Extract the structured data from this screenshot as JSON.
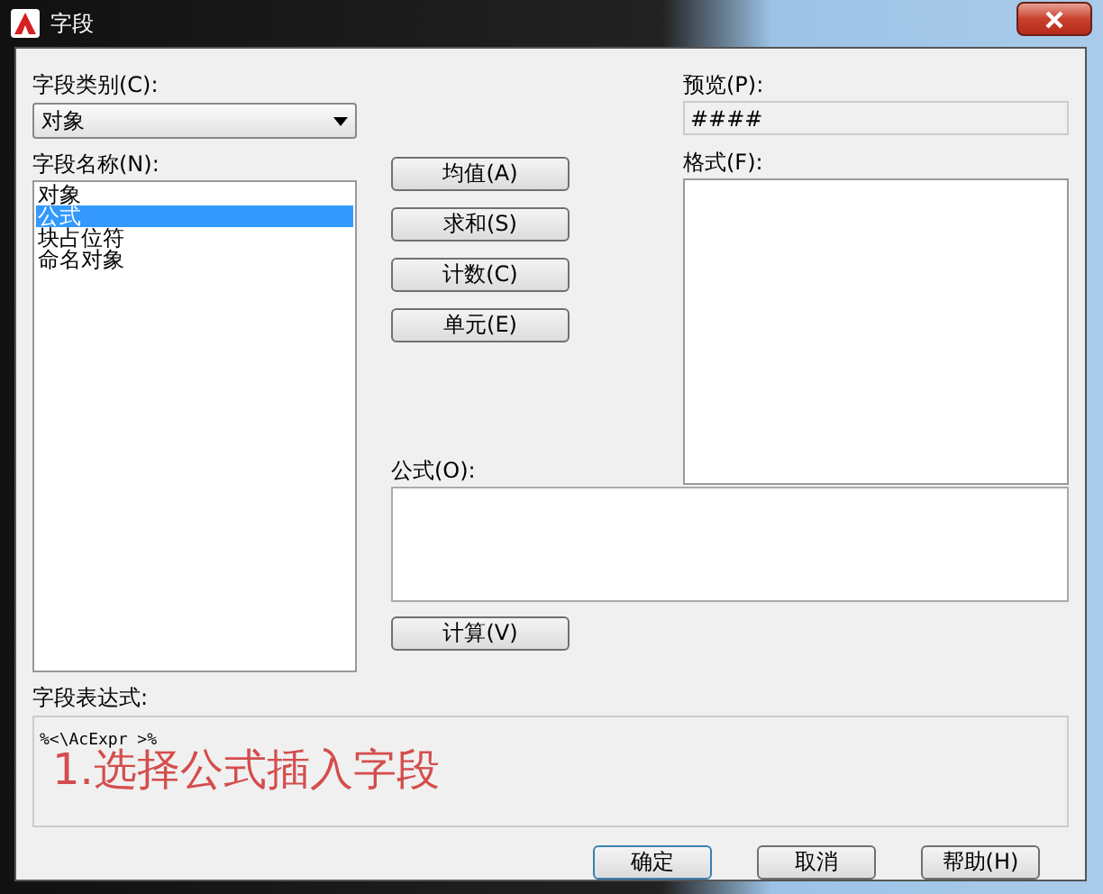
{
  "window": {
    "title": "字段"
  },
  "category": {
    "label": "字段类别(C):",
    "value": "对象"
  },
  "names": {
    "label": "字段名称(N):",
    "items": [
      {
        "text": "对象",
        "selected": false
      },
      {
        "text": "公式",
        "selected": true
      },
      {
        "text": "块占位符",
        "selected": false
      },
      {
        "text": "命名对象",
        "selected": false
      }
    ]
  },
  "function_buttons": [
    "均值(A)",
    "求和(S)",
    "计数(C)",
    "单元(E)"
  ],
  "preview": {
    "label": "预览(P):",
    "value": "####"
  },
  "format": {
    "label": "格式(F):"
  },
  "formula": {
    "label": "公式(O):",
    "button": "计算(V)"
  },
  "expression": {
    "label": "字段表达式:",
    "value": "%<\\AcExpr >%"
  },
  "annotation": "1.选择公式插入字段",
  "buttons": [
    "确定",
    "取消",
    "帮助(H)"
  ]
}
